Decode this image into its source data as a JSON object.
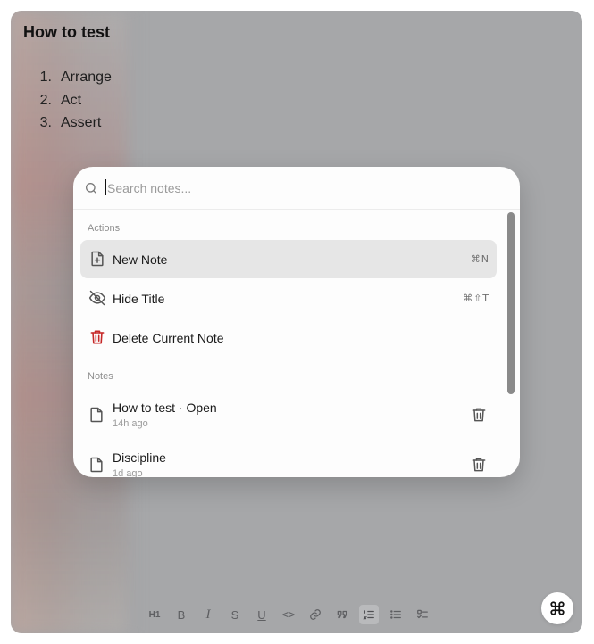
{
  "document": {
    "title": "How to test",
    "list": [
      {
        "num": "1",
        "text": "Arrange"
      },
      {
        "num": "2",
        "text": "Act"
      },
      {
        "num": "3",
        "text": "Assert"
      }
    ]
  },
  "palette": {
    "search_placeholder": "Search notes...",
    "search_value": "",
    "actions_label": "Actions",
    "actions": [
      {
        "label": "New Note",
        "shortcut": "⌘N",
        "icon": "file-plus-icon",
        "selected": true
      },
      {
        "label": "Hide Title",
        "shortcut": "⌘⇧T",
        "icon": "eye-off-icon",
        "selected": false
      },
      {
        "label": "Delete Current Note",
        "shortcut": "",
        "icon": "trash-icon",
        "selected": false
      }
    ],
    "notes_label": "Notes",
    "notes": [
      {
        "title": "How to test · Open",
        "time": "14h ago"
      },
      {
        "title": "Discipline",
        "time": "1d ago"
      }
    ]
  },
  "toolbar": {
    "heading_label": "H1",
    "bold_label": "B",
    "italic_label": "I",
    "strike_label": "S",
    "underline_label": "U",
    "code_label": "<>"
  },
  "colors": {
    "backdrop": "#a6a7a9",
    "palette_bg": "#fdfdfd",
    "selected_bg": "#e6e6e6",
    "danger": "#c62828"
  }
}
